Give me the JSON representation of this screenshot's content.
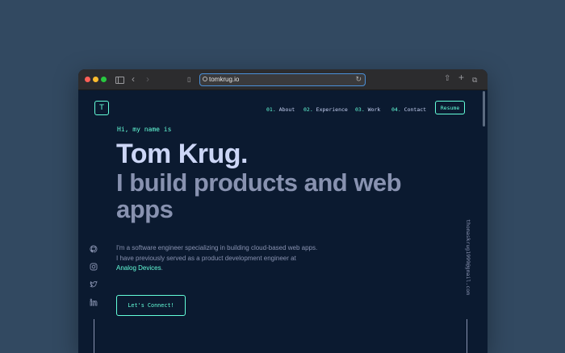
{
  "browser": {
    "url": "tomkrug.io"
  },
  "site": {
    "logo_letter": "T",
    "nav": [
      {
        "num": "01.",
        "label": "About"
      },
      {
        "num": "02.",
        "label": "Experience"
      },
      {
        "num": "03.",
        "label": "Work"
      },
      {
        "num": "04.",
        "label": "Contact"
      }
    ],
    "resume_label": "Resume"
  },
  "hero": {
    "greeting": "Hi, my name is",
    "name": "Tom Krug.",
    "tagline": "I build products and web apps",
    "bio_line1": "I'm a software engineer specializing in building cloud-based web apps.",
    "bio_line2": "I have previously served as a product development engineer at",
    "bio_link": "Analog Devices",
    "bio_end": ".",
    "cta_label": "Let's Connect!"
  },
  "email": "thomaskrug1999@gmail.com",
  "social_icons": [
    "github-icon",
    "instagram-icon",
    "twitter-icon",
    "linkedin-icon"
  ],
  "colors": {
    "accent": "#64ffda",
    "background": "#0b1a30",
    "heading": "#ccd6f6",
    "muted": "#8892b0"
  }
}
